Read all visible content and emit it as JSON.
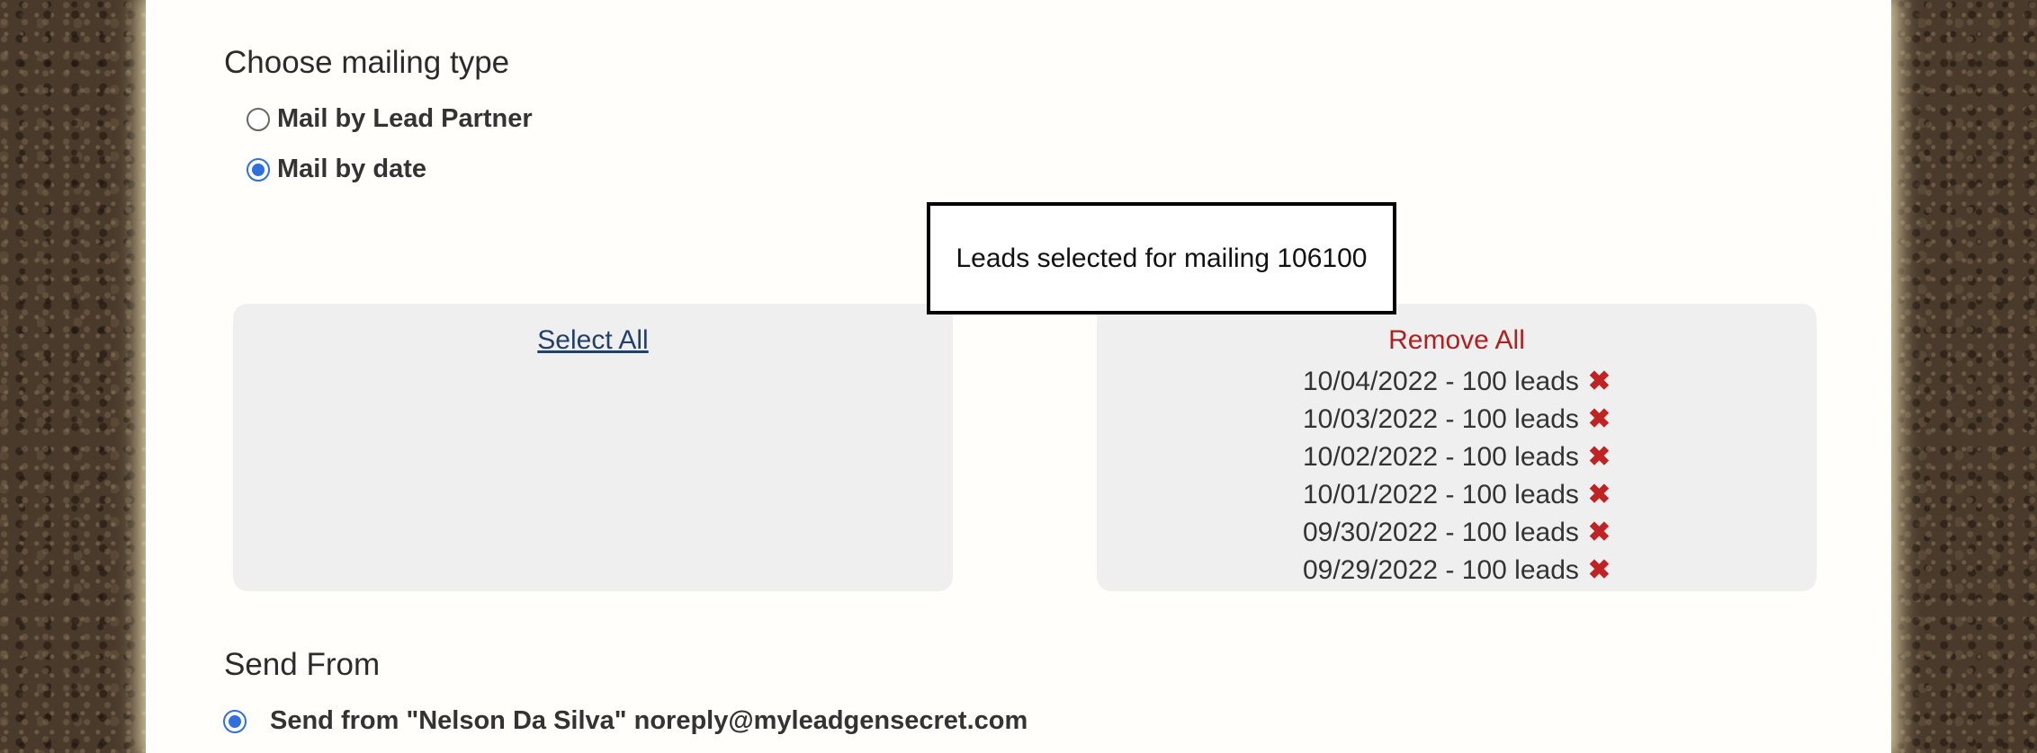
{
  "mailing_type": {
    "title": "Choose mailing type",
    "options": [
      {
        "label": "Mail by Lead Partner",
        "checked": false
      },
      {
        "label": "Mail by date",
        "checked": true
      }
    ]
  },
  "counter": {
    "text": "Leads selected for mailing 106100"
  },
  "available": {
    "select_all_label": "Select All"
  },
  "selected": {
    "remove_all_label": "Remove All",
    "items": [
      {
        "label": "10/04/2022 - 100 leads"
      },
      {
        "label": "10/03/2022 - 100 leads"
      },
      {
        "label": "10/02/2022 - 100 leads"
      },
      {
        "label": "10/01/2022 - 100 leads"
      },
      {
        "label": "09/30/2022 - 100 leads"
      },
      {
        "label": "09/29/2022 - 100 leads"
      }
    ],
    "remove_icon": "close-x-icon",
    "remove_glyph": "✖"
  },
  "send_from": {
    "title": "Send From",
    "option": {
      "label": "Send from \"Nelson Da Silva\" noreply@myleadgensecret.com",
      "checked": true
    }
  },
  "colors": {
    "accent": "#2f6fde",
    "remove": "#b21f1f",
    "link": "#23406b",
    "box_bg": "#efefef"
  }
}
